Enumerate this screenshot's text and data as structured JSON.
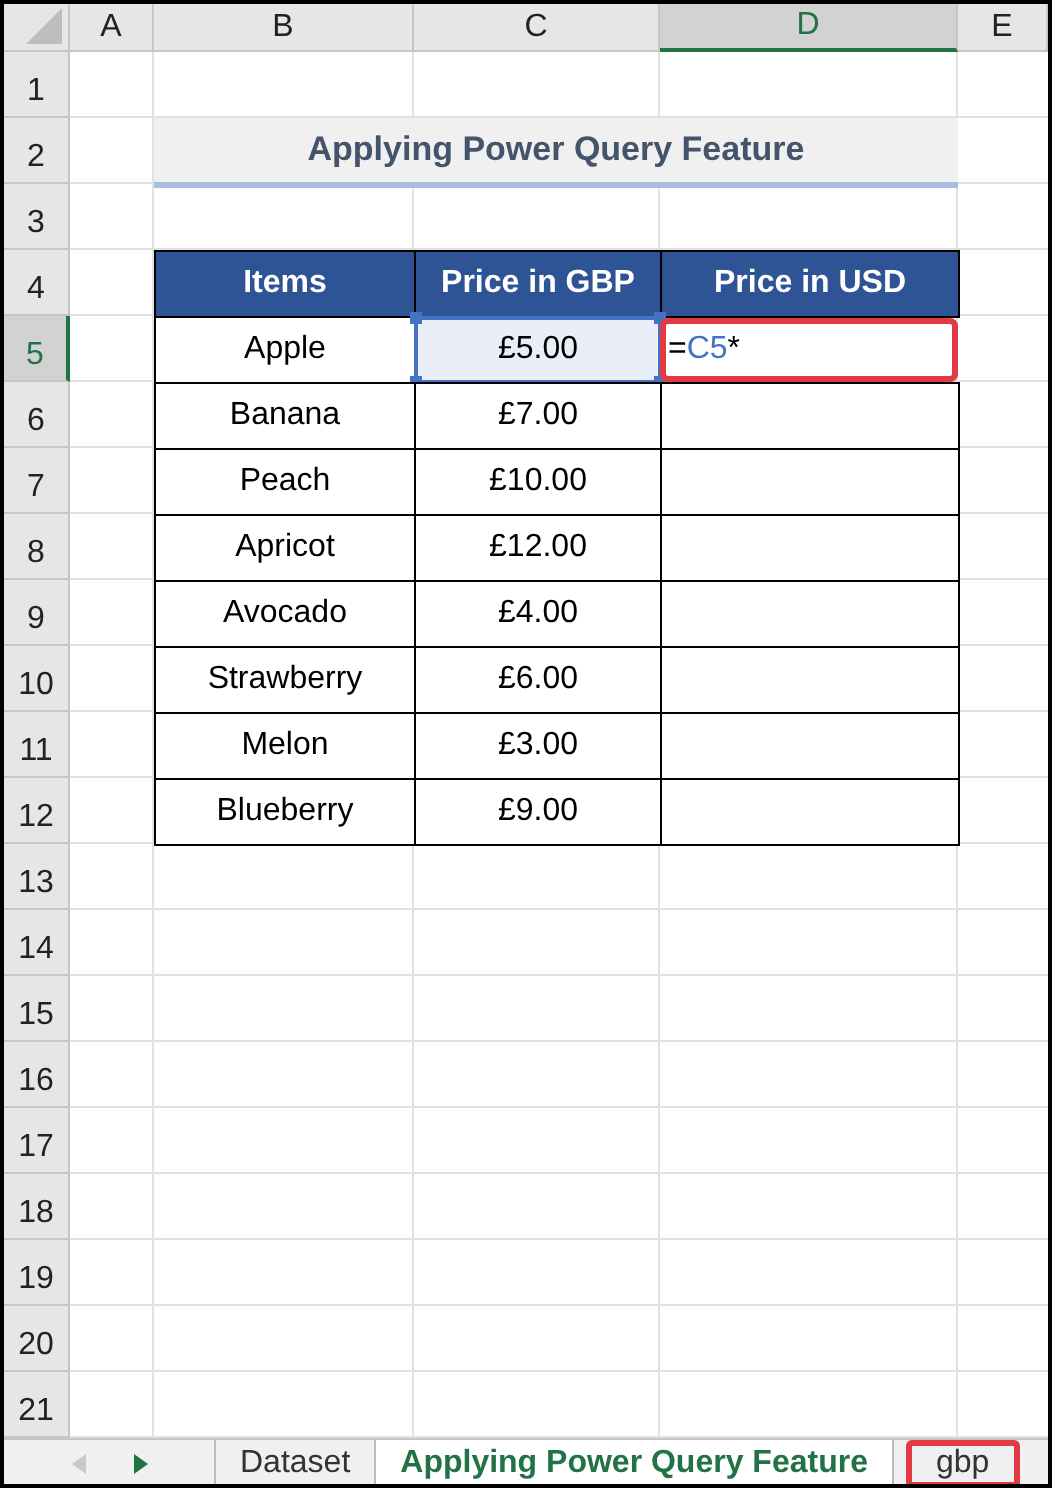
{
  "column_headers": [
    {
      "label": "A",
      "selected": false
    },
    {
      "label": "B",
      "selected": false
    },
    {
      "label": "C",
      "selected": false
    },
    {
      "label": "D",
      "selected": true
    },
    {
      "label": "E",
      "selected": false
    }
  ],
  "row_headers": [
    {
      "label": "1",
      "selected": false
    },
    {
      "label": "2",
      "selected": false
    },
    {
      "label": "3",
      "selected": false
    },
    {
      "label": "4",
      "selected": false
    },
    {
      "label": "5",
      "selected": true
    },
    {
      "label": "6",
      "selected": false
    },
    {
      "label": "7",
      "selected": false
    },
    {
      "label": "8",
      "selected": false
    },
    {
      "label": "9",
      "selected": false
    },
    {
      "label": "10",
      "selected": false
    },
    {
      "label": "11",
      "selected": false
    },
    {
      "label": "12",
      "selected": false
    },
    {
      "label": "13",
      "selected": false
    },
    {
      "label": "14",
      "selected": false
    },
    {
      "label": "15",
      "selected": false
    },
    {
      "label": "16",
      "selected": false
    },
    {
      "label": "17",
      "selected": false
    },
    {
      "label": "18",
      "selected": false
    },
    {
      "label": "19",
      "selected": false
    },
    {
      "label": "20",
      "selected": false
    },
    {
      "label": "21",
      "selected": false
    }
  ],
  "title": "Applying Power Query Feature",
  "table": {
    "columns": [
      "Items",
      "Price in GBP",
      "Price in USD"
    ],
    "rows": [
      {
        "cells": [
          {
            "text": "Apple"
          },
          {
            "text": "£5.00",
            "referenced": true
          },
          {
            "formula": [
              {
                "kind": "operator",
                "text": "="
              },
              {
                "kind": "reference",
                "text": "C5"
              },
              {
                "kind": "operator",
                "text": "*"
              }
            ],
            "highlighted": true
          }
        ]
      },
      {
        "cells": [
          {
            "text": "Banana"
          },
          {
            "text": "£7.00"
          }
        ]
      },
      {
        "cells": [
          {
            "text": "Peach"
          },
          {
            "text": "£10.00"
          }
        ]
      },
      {
        "cells": [
          {
            "text": "Apricot"
          },
          {
            "text": "£12.00"
          }
        ]
      },
      {
        "cells": [
          {
            "text": "Avocado"
          },
          {
            "text": "£4.00"
          }
        ]
      },
      {
        "cells": [
          {
            "text": "Strawberry"
          },
          {
            "text": "£6.00"
          }
        ]
      },
      {
        "cells": [
          {
            "text": "Melon"
          },
          {
            "text": "£3.00"
          }
        ]
      },
      {
        "cells": [
          {
            "text": "Blueberry"
          },
          {
            "text": "£9.00"
          }
        ]
      }
    ]
  },
  "sheet_tabs": [
    {
      "label": "Dataset",
      "selected": false,
      "highlighted": false
    },
    {
      "label": "Applying Power Query Feature",
      "selected": true,
      "highlighted": false
    },
    {
      "label": "gbp",
      "selected": false,
      "highlighted": true
    }
  ]
}
